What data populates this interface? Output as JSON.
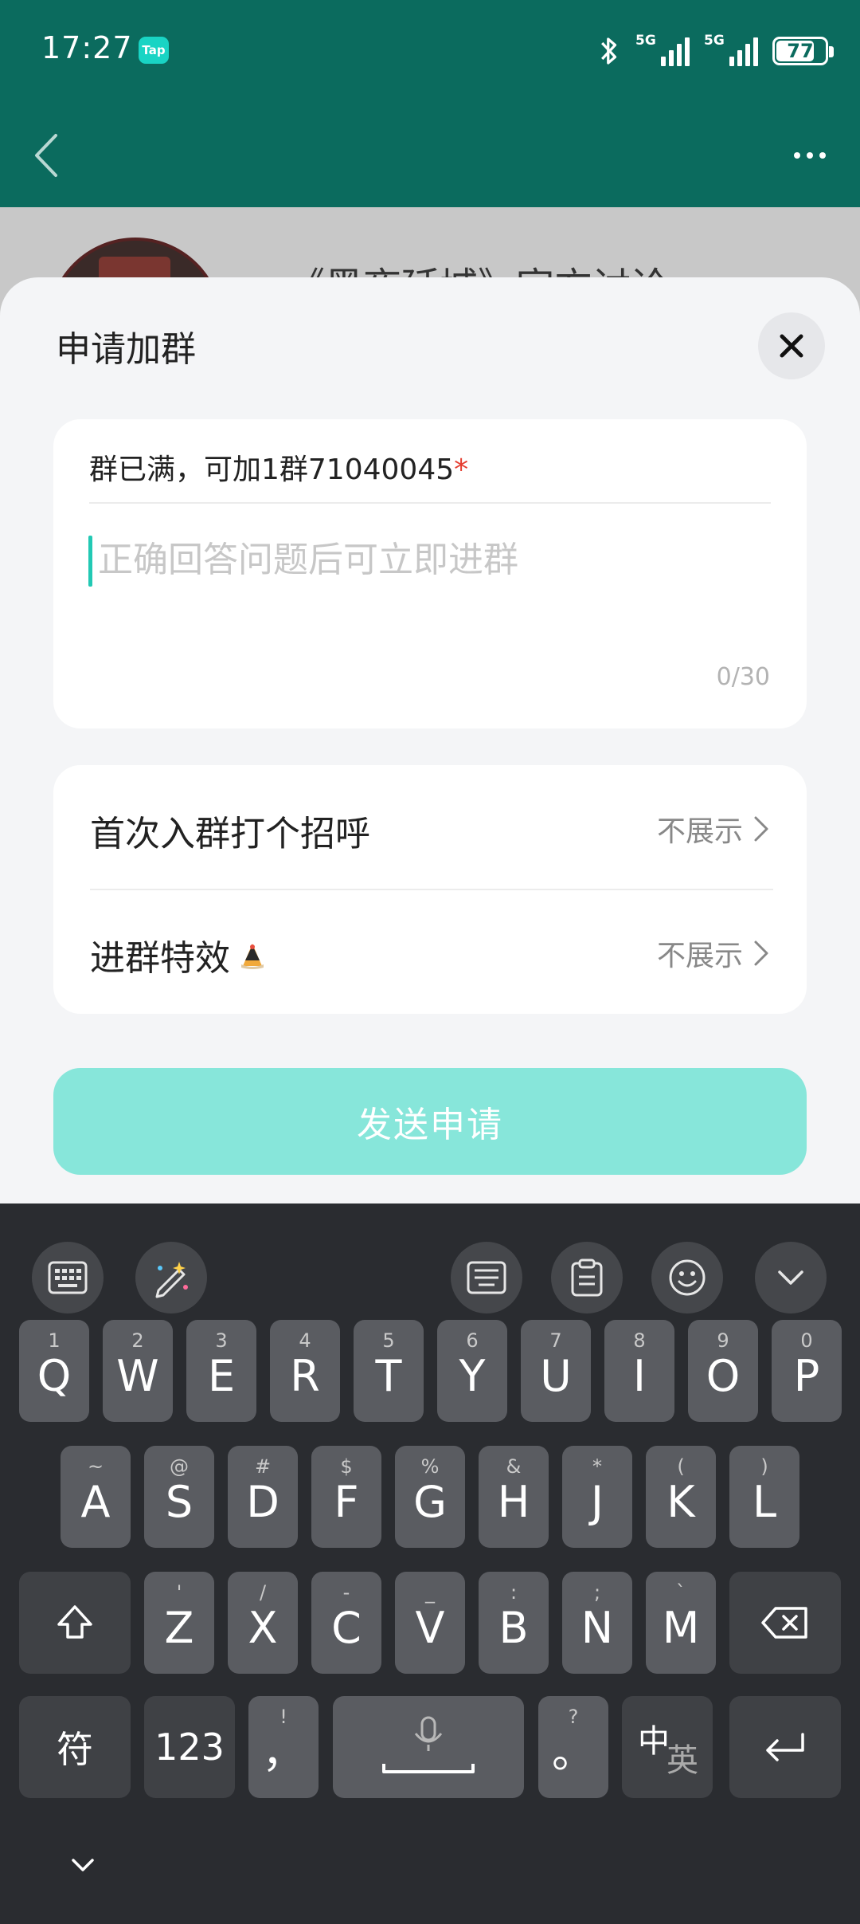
{
  "status_bar": {
    "time": "17:27",
    "app_badge": "Tap",
    "signal_1_label": "5G",
    "signal_2_label": "5G",
    "battery": "77"
  },
  "background_page": {
    "group_title_partial": "《黑夜延城》官方讨论"
  },
  "sheet": {
    "title": "申请加群",
    "question_label": "群已满，可加1群71040045",
    "question_required_mark": "*",
    "answer_placeholder": "正确回答问题后可立即进群",
    "char_count": "0/30",
    "options": [
      {
        "label": "首次入群打个招呼",
        "value": "不展示"
      },
      {
        "label": "进群特效",
        "value": "不展示"
      }
    ],
    "submit_label": "发送申请"
  },
  "keyboard": {
    "row1": [
      {
        "main": "Q",
        "sub": "1"
      },
      {
        "main": "W",
        "sub": "2"
      },
      {
        "main": "E",
        "sub": "3"
      },
      {
        "main": "R",
        "sub": "4"
      },
      {
        "main": "T",
        "sub": "5"
      },
      {
        "main": "Y",
        "sub": "6"
      },
      {
        "main": "U",
        "sub": "7"
      },
      {
        "main": "I",
        "sub": "8"
      },
      {
        "main": "O",
        "sub": "9"
      },
      {
        "main": "P",
        "sub": "0"
      }
    ],
    "row2": [
      {
        "main": "A",
        "sub": "~"
      },
      {
        "main": "S",
        "sub": "@"
      },
      {
        "main": "D",
        "sub": "#"
      },
      {
        "main": "F",
        "sub": "$"
      },
      {
        "main": "G",
        "sub": "%"
      },
      {
        "main": "H",
        "sub": "&"
      },
      {
        "main": "J",
        "sub": "*"
      },
      {
        "main": "K",
        "sub": "("
      },
      {
        "main": "L",
        "sub": ")"
      }
    ],
    "row3": [
      {
        "main": "Z",
        "sub": "'"
      },
      {
        "main": "X",
        "sub": "/"
      },
      {
        "main": "C",
        "sub": "-"
      },
      {
        "main": "V",
        "sub": "_"
      },
      {
        "main": "B",
        "sub": ":"
      },
      {
        "main": "N",
        "sub": ";"
      },
      {
        "main": "M",
        "sub": "`"
      }
    ],
    "symbols_label": "符",
    "numbers_label": "123",
    "comma_main": "，",
    "comma_sub": "!",
    "period_main": "。",
    "period_sub": "?",
    "lang_top": "中",
    "lang_bottom": "英"
  }
}
